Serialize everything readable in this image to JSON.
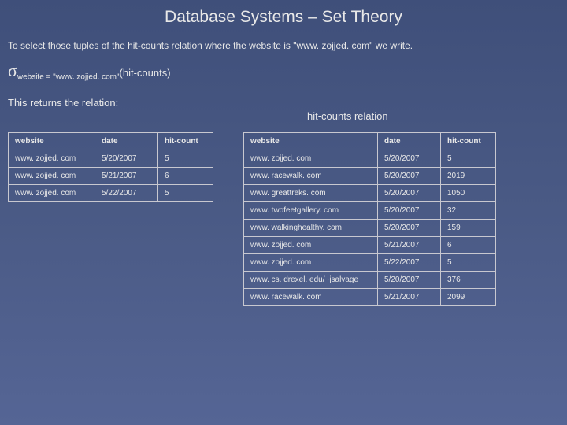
{
  "title": "Database Systems – Set Theory",
  "intro": "To select those tuples of the hit-counts relation where the website is \"www. zojjed. com\" we write.",
  "formula": {
    "sigma": "σ",
    "subscript": "website = \"www. zojjed. com\"",
    "arg": "(hit-counts)"
  },
  "returns_text": "This returns the relation:",
  "right_label": "hit-counts relation",
  "left_table": {
    "headers": [
      "website",
      "date",
      "hit-count"
    ],
    "rows": [
      [
        "www. zojjed. com",
        "5/20/2007",
        "5"
      ],
      [
        "www. zojjed. com",
        "5/21/2007",
        "6"
      ],
      [
        "www. zojjed. com",
        "5/22/2007",
        "5"
      ]
    ]
  },
  "right_table": {
    "headers": [
      "website",
      "date",
      "hit-count"
    ],
    "rows": [
      [
        "www. zojjed. com",
        "5/20/2007",
        "5"
      ],
      [
        "www. racewalk. com",
        "5/20/2007",
        "2019"
      ],
      [
        "www. greattreks. com",
        "5/20/2007",
        "1050"
      ],
      [
        "www. twofeetgallery. com",
        "5/20/2007",
        "32"
      ],
      [
        "www. walkinghealthy. com",
        "5/20/2007",
        "159"
      ],
      [
        "www. zojjed. com",
        "5/21/2007",
        "6"
      ],
      [
        "www. zojjed. com",
        "5/22/2007",
        "5"
      ],
      [
        "www. cs. drexel. edu/~jsalvage",
        "5/20/2007",
        "376"
      ],
      [
        "www. racewalk. com",
        "5/21/2007",
        "2099"
      ]
    ]
  }
}
